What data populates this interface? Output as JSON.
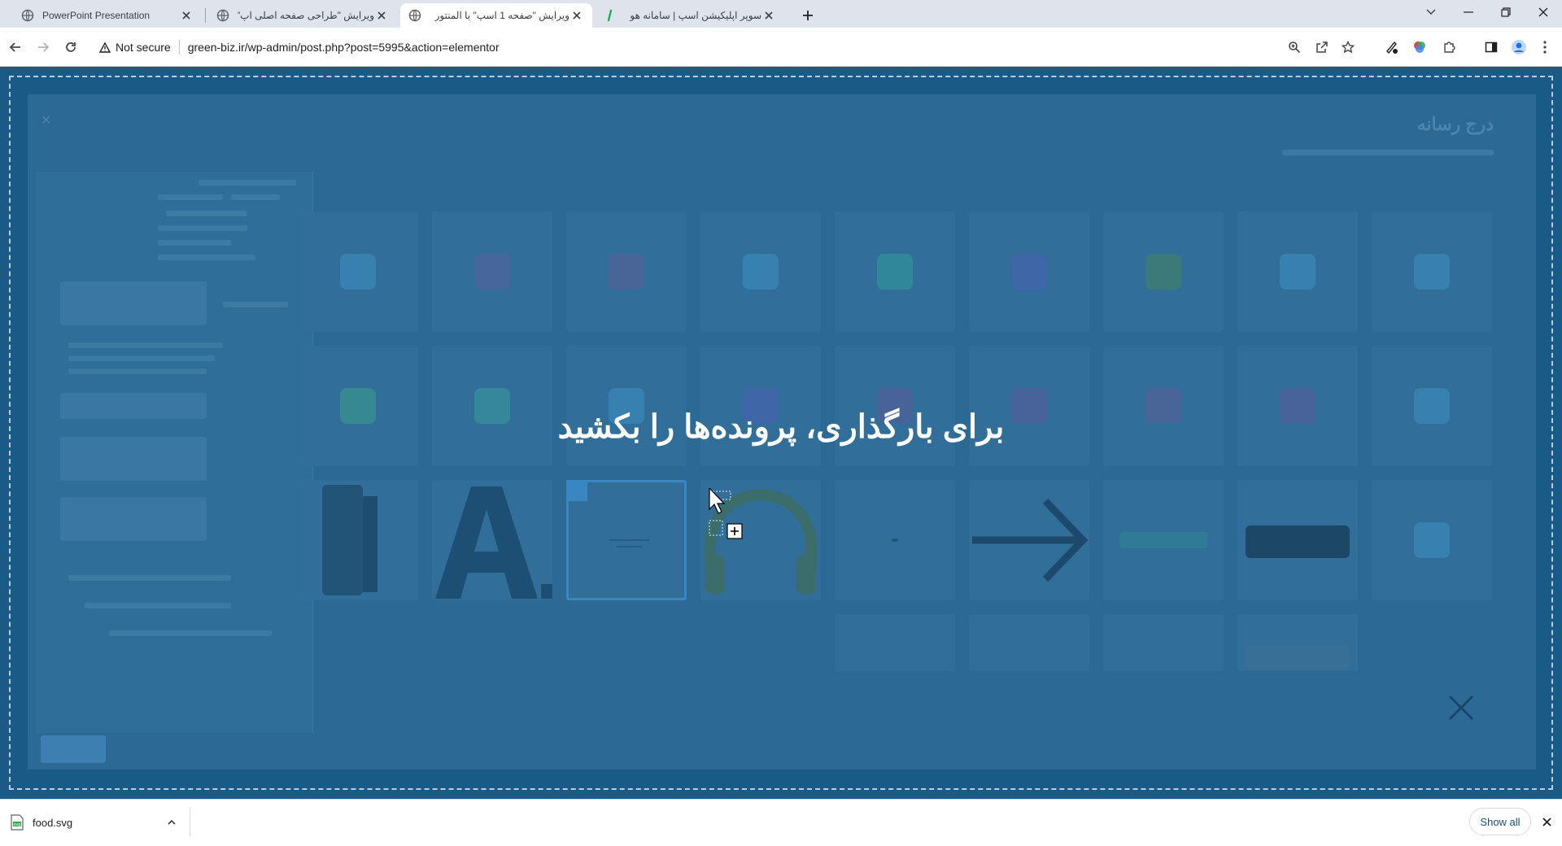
{
  "browser": {
    "tabs": [
      {
        "title": "PowerPoint Presentation",
        "active": false
      },
      {
        "title": "ویرایش \"طراحی صفحه اصلی اپ\"",
        "active": false
      },
      {
        "title": "ویرایش \"صفحه 1 اسپ\" با المنتور",
        "active": true
      },
      {
        "title": "سوپر اپلیکیشن اسپ | سامانه هو",
        "active": false
      }
    ],
    "security_label": "Not secure",
    "url": "green-biz.ir/wp-admin/post.php?post=5995&action=elementor"
  },
  "overlay": {
    "drop_text": "برای بارگذاری، پرونده‌ها را بکشید",
    "modal_title": "درج رسانه",
    "dim_color": "#1a5a86"
  },
  "media_grid": {
    "icon_colors": [
      "#3d8fc4",
      "#5a5e9a",
      "#5d5b95",
      "#3d8fc4",
      "#2f9a9a",
      "#4a5fb0",
      "#46825f",
      "#3d8fc4",
      "#3d8fc4",
      "#3a9f8a",
      "#3a9a9a",
      "#3d8fc4",
      "#4a5fb0",
      "#5a5a95",
      "#5a5a95",
      "#5d5b95",
      "#5a5a95",
      "#3d8fc4"
    ]
  },
  "download_bar": {
    "file_name": "food.svg",
    "show_all_label": "Show all"
  }
}
